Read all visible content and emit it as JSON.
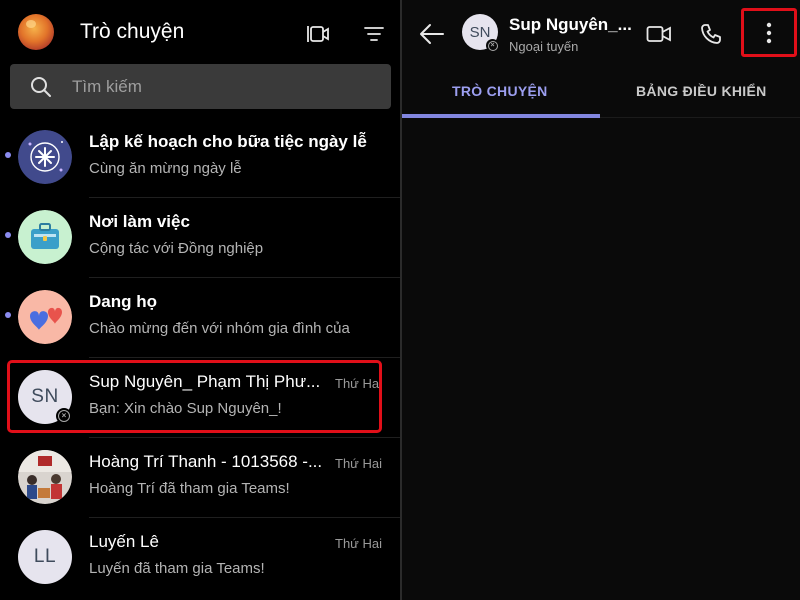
{
  "left_header": {
    "title": "Trò chuyện"
  },
  "search": {
    "placeholder": "Tìm kiếm"
  },
  "chats": [
    {
      "name": "Lập kế hoạch cho bữa tiệc ngày lễ",
      "preview": "Cùng ăn mừng ngày lễ",
      "time": "",
      "unread": true,
      "avatar": "party-avatar"
    },
    {
      "name": "Nơi làm việc",
      "preview": "Cộng tác với Đồng nghiệp",
      "time": "",
      "unread": true,
      "avatar": "briefcase-avatar"
    },
    {
      "name": "Dang họ",
      "preview": "Chào mừng đến với nhóm gia đình của",
      "time": "",
      "unread": true,
      "avatar": "hearts-avatar"
    },
    {
      "name": "Sup Nguyên_ Phạm Thị Phư...",
      "preview": "Bạn: Xin chào Sup Nguyên_!",
      "time": "Thứ Hai",
      "unread": false,
      "initials": "SN"
    },
    {
      "name": "Hoàng Trí Thanh - 1013568 -...",
      "preview": "Hoàng Trí đã tham gia Teams!",
      "time": "Thứ Hai",
      "unread": false,
      "avatar": "photo-avatar"
    },
    {
      "name": "Luyến Lê",
      "preview": "Luyến đã tham gia Teams!",
      "time": "Thứ Hai",
      "unread": false,
      "initials": "LL"
    }
  ],
  "conversation": {
    "initials": "SN",
    "name": "Sup Nguyên_...",
    "status": "Ngoại tuyến",
    "tabs": [
      {
        "label": "TRÒ CHUYỆN",
        "active": true
      },
      {
        "label": "BẢNG ĐIỀU KHIỂN",
        "active": false
      }
    ]
  },
  "colors": {
    "accent": "#8286e0",
    "highlight": "#e10f19",
    "background": "#000000"
  }
}
